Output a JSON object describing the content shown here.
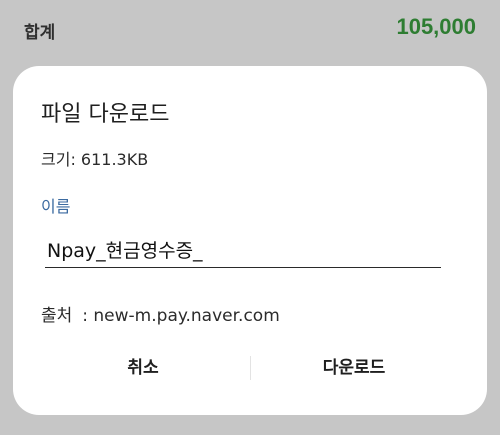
{
  "summary": {
    "label": "합계",
    "amount": "105,000",
    "amount_color": "#2e7d32"
  },
  "dialog": {
    "title": "파일 다운로드",
    "size_text": "크기: 611.3KB",
    "name_label": "이름",
    "filename_value": "Npay_현금영수증_",
    "source_label": "출처",
    "source_value": ": new-m.pay.naver.com",
    "cancel_label": "취소",
    "download_label": "다운로드",
    "accent_color": "#3b6aa0"
  }
}
